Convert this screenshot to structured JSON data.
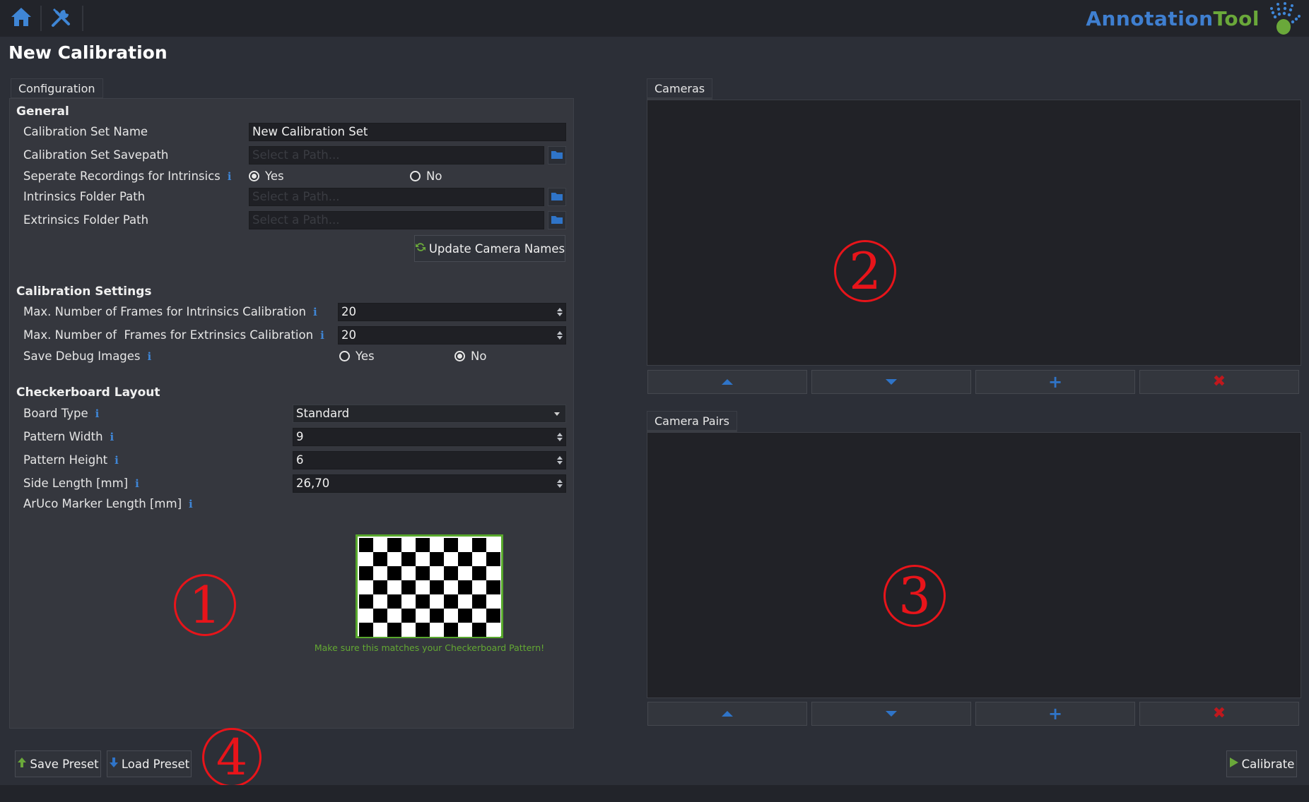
{
  "app": {
    "brand_part1": "Annotation",
    "brand_part2": "Tool",
    "page_title": "New Calibration"
  },
  "toolbar": {
    "home_icon": "home-icon",
    "tools_icon": "tools-icon"
  },
  "tabs": {
    "configuration": "Configuration",
    "cameras": "Cameras",
    "camera_pairs": "Camera Pairs"
  },
  "general": {
    "heading": "General",
    "set_name_label": "Calibration Set Name",
    "set_name_value": "New Calibration Set",
    "savepath_label": "Calibration Set Savepath",
    "savepath_placeholder": "Select a Path...",
    "separate_label": "Seperate Recordings for Intrinsics",
    "separate_yes": "Yes",
    "separate_no": "No",
    "separate_selected": "Yes",
    "intrinsics_label": "Intrinsics Folder Path",
    "intrinsics_placeholder": "Select a Path...",
    "extrinsics_label": "Extrinsics Folder Path",
    "extrinsics_placeholder": "Select a Path...",
    "update_button": "Update Camera Names"
  },
  "calibration": {
    "heading": "Calibration Settings",
    "max_intr_label": "Max. Number of Frames for Intrinsics Calibration",
    "max_intr_value": "20",
    "max_extr_label": "Max. Number of  Frames for Extrinsics Calibration",
    "max_extr_value": "20",
    "debug_label": "Save Debug Images",
    "debug_yes": "Yes",
    "debug_no": "No",
    "debug_selected": "No"
  },
  "checkerboard": {
    "heading": "Checkerboard Layout",
    "board_type_label": "Board Type",
    "board_type_value": "Standard",
    "pattern_width_label": "Pattern Width",
    "pattern_width_value": "9",
    "pattern_height_label": "Pattern Height",
    "pattern_height_value": "6",
    "side_length_label": "Side Length [mm]",
    "side_length_value": "26,70",
    "aruco_label": "ArUco Marker Length [mm]",
    "caption": "Make sure this matches your Checkerboard Pattern!",
    "preview_cols": 10,
    "preview_rows": 7
  },
  "annotations": {
    "n1": "1",
    "n2": "2",
    "n3": "3",
    "n4": "4"
  },
  "footer": {
    "save_preset": "Save Preset",
    "load_preset": "Load Preset",
    "calibrate": "Calibrate"
  },
  "colors": {
    "accent_blue": "#3f7fd0",
    "accent_green": "#6aa83a",
    "delete_red": "#c0181d",
    "annotation_red": "#e8141a"
  }
}
